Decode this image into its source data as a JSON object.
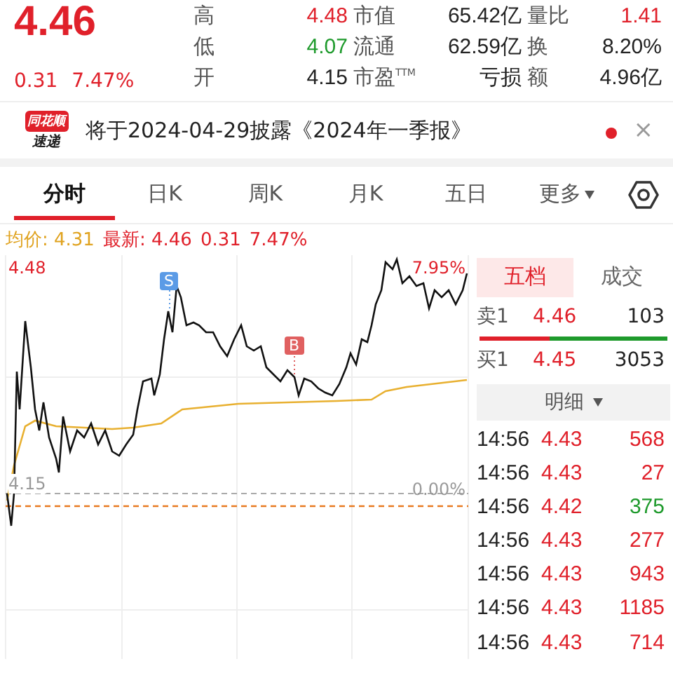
{
  "quote": {
    "price": "4.46",
    "change": "0.31",
    "change_pct": "7.47%"
  },
  "stats": [
    {
      "label": "高",
      "value": "4.48",
      "color": "#e0202a"
    },
    {
      "label": "市值",
      "value": "65.42亿",
      "color": "#222222"
    },
    {
      "label": "量比",
      "value": "1.41",
      "color": "#e0202a"
    },
    {
      "label": "低",
      "value": "4.07",
      "color": "#1e9a2c"
    },
    {
      "label": "流通",
      "value": "62.59亿",
      "color": "#222222"
    },
    {
      "label": "换",
      "value": "8.20%",
      "color": "#222222"
    },
    {
      "label": "开",
      "value": "4.15",
      "color": "#222222"
    },
    {
      "label": "市盈$^{TTM}$",
      "value": "亏损",
      "color": "#222222"
    },
    {
      "label": "额",
      "value": "4.96亿",
      "color": "#222222"
    }
  ],
  "notice": {
    "logo_top": "同花顺",
    "logo_bottom": "速递",
    "text": "将于2024-04-29披露《2024年一季报》",
    "unread": true,
    "close": "×"
  },
  "tabs": [
    {
      "label": "分时",
      "selected": true
    },
    {
      "label": "日K",
      "selected": false
    },
    {
      "label": "周K",
      "selected": false
    },
    {
      "label": "月K",
      "selected": false
    },
    {
      "label": "五日",
      "selected": false
    },
    {
      "label": "更多",
      "selected": false,
      "kind": "menu"
    }
  ],
  "chart_info": {
    "avg_label": "均价: 4.31",
    "latest_label": "最新: 4.46",
    "change": "0.31",
    "change_pct": "7.47%"
  },
  "chart": {
    "high": "4.48",
    "high_pct": "7.95%",
    "open": "4.15",
    "open_pct": "0.00%",
    "sell_mark": "S",
    "buy_mark": "B"
  },
  "book_tabs": [
    {
      "label": "五档",
      "selected": true
    },
    {
      "label": "成交",
      "selected": false
    }
  ],
  "book": [
    {
      "label": "卖1",
      "price": "4.46",
      "volume": "103"
    },
    {
      "label": "买1",
      "price": "4.45",
      "volume": "3053"
    }
  ],
  "book_ratio": {
    "level": 0.37
  },
  "trades_header": "明细",
  "trades": [
    {
      "time": "14:56",
      "price": "4.43",
      "volume": "568",
      "color": "#e0202a"
    },
    {
      "time": "14:56",
      "price": "4.43",
      "volume": "27",
      "color": "#e0202a"
    },
    {
      "time": "14:56",
      "price": "4.42",
      "volume": "375",
      "color": "#1e9a2c"
    },
    {
      "time": "14:56",
      "price": "4.43",
      "volume": "277",
      "color": "#e0202a"
    },
    {
      "time": "14:56",
      "price": "4.43",
      "volume": "943",
      "color": "#e0202a"
    },
    {
      "time": "14:56",
      "price": "4.43",
      "volume": "1185",
      "color": "#e0202a"
    },
    {
      "time": "14:56",
      "price": "4.43",
      "volume": "714",
      "color": "#e0202a"
    }
  ]
}
